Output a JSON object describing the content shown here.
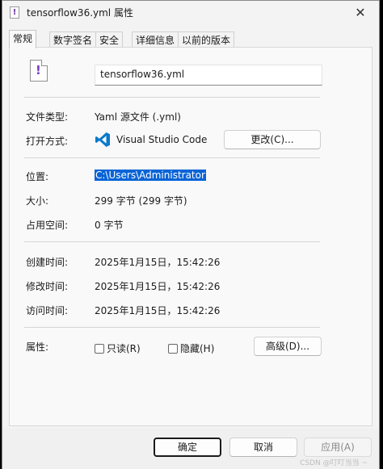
{
  "window": {
    "title": "tensorflow36.yml 属性",
    "close_glyph": "✕",
    "file_icon_glyph": "!"
  },
  "tabs": [
    {
      "label": "常规",
      "active": true
    },
    {
      "label": "数字签名"
    },
    {
      "label": "安全"
    },
    {
      "label": "详细信息"
    },
    {
      "label": "以前的版本"
    }
  ],
  "general": {
    "file_name": "tensorflow36.yml",
    "type_label": "文件类型:",
    "type_value": "Yaml 源文件 (.yml)",
    "open_with_label": "打开方式:",
    "open_with_app": "Visual Studio Code",
    "change_button": "更改(C)...",
    "location_label": "位置:",
    "location_value": "C:\\Users\\Administrator",
    "size_label": "大小:",
    "size_value": "299 字节 (299 字节)",
    "disk_size_label": "占用空间:",
    "disk_size_value": "0 字节",
    "created_label": "创建时间:",
    "created_value": "2025年1月15日，15:42:26",
    "modified_label": "修改时间:",
    "modified_value": "2025年1月15日，15:42:26",
    "accessed_label": "访问时间:",
    "accessed_value": "2025年1月15日，15:42:26",
    "attributes_label": "属性:",
    "readonly_label": "只读(R)",
    "hidden_label": "隐藏(H)",
    "advanced_button": "高级(D)..."
  },
  "footer": {
    "ok": "确定",
    "cancel": "取消",
    "apply": "应用(A)",
    "watermark": "CSDN @叮叮当当 ~"
  },
  "colors": {
    "selection": "#0a64d6",
    "vscode_blue": "#0a7acc",
    "file_mark": "#7a3dbf"
  }
}
